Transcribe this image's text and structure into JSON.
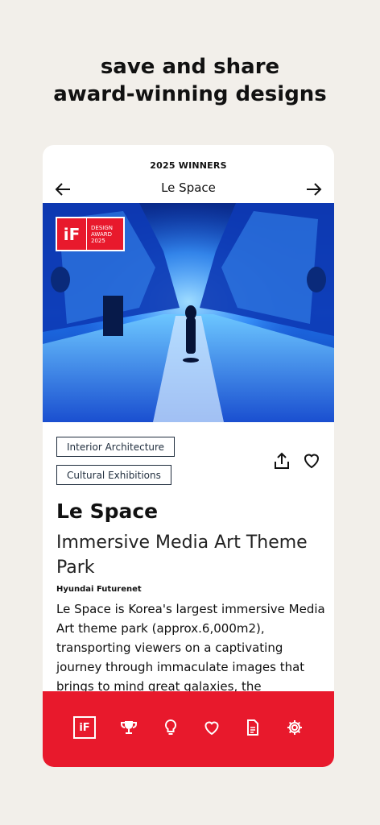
{
  "headline": {
    "line1": "save and share",
    "line2": "award-winning designs"
  },
  "card": {
    "eyebrow": "2025 WINNERS",
    "nav": {
      "title": "Le Space",
      "back_icon": "arrow-left-icon",
      "forward_icon": "arrow-right-icon"
    },
    "badge": {
      "logo": "iF",
      "line1": "DESIGN",
      "line2": "AWARD",
      "line3": "2025"
    },
    "tags": [
      "Interior Architecture",
      "Cultural Exhibitions"
    ],
    "actions": [
      "share-icon",
      "heart-icon"
    ],
    "title": "Le Space",
    "subtitle": "Immersive Media Art Theme Park",
    "company": "Hyundai Futurenet",
    "description": "Le Space is Korea's largest immersive Media Art theme park (approx.6,000m2), transporting viewers on a captivating journey through immaculate images that brings to mind great galaxies, the"
  },
  "tabbar": {
    "items": [
      "if-logo-icon",
      "trophy-icon",
      "lightbulb-icon",
      "heart-icon",
      "document-icon",
      "settings-gear-icon"
    ],
    "active": "if-logo-icon"
  },
  "colors": {
    "brand_red": "#e8192c",
    "background": "#f2efea",
    "tag_border": "#1f2d3d"
  }
}
